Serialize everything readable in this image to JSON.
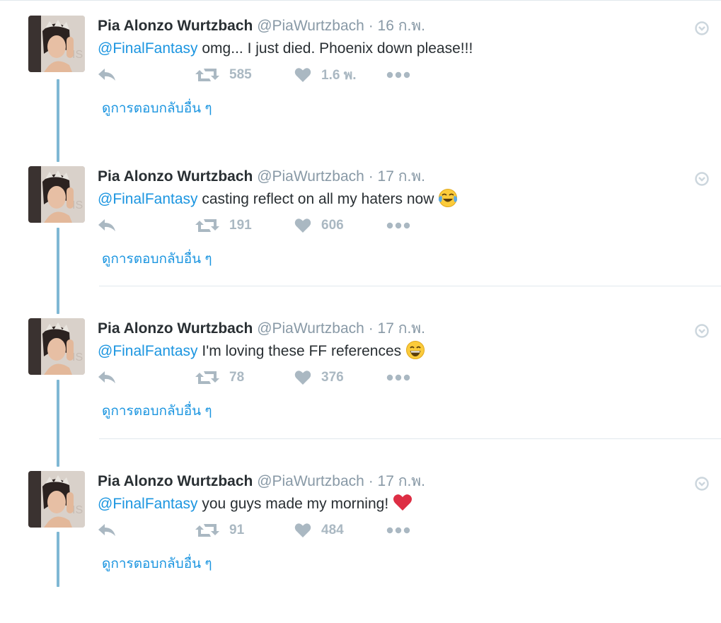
{
  "thread": {
    "more_replies_label": "ดูการตอบกลับอื่น ๆ",
    "mention_color": "#1b95e0",
    "thread_line_color": "#7fb8d4",
    "action_icon_color": "#aab8c2"
  },
  "tweets": [
    {
      "name": "Pia Alonzo Wurtzbach",
      "handle": "@PiaWurtzbach",
      "separator": "·",
      "time": "16 ก.พ.",
      "mention": "@FinalFantasy",
      "text": " omg... I just died. Phoenix down please!!!",
      "emoji": "",
      "retweets": "585",
      "likes": "1.6 พ."
    },
    {
      "name": "Pia Alonzo Wurtzbach",
      "handle": "@PiaWurtzbach",
      "separator": "·",
      "time": "17 ก.พ.",
      "mention": "@FinalFantasy",
      "text": " casting reflect on all my haters now",
      "emoji": "face-with-tears-of-joy",
      "retweets": "191",
      "likes": "606"
    },
    {
      "name": "Pia Alonzo Wurtzbach",
      "handle": "@PiaWurtzbach",
      "separator": "·",
      "time": "17 ก.พ.",
      "mention": "@FinalFantasy",
      "text": " I'm loving these FF references",
      "emoji": "grinning-face",
      "retweets": "78",
      "likes": "376"
    },
    {
      "name": "Pia Alonzo Wurtzbach",
      "handle": "@PiaWurtzbach",
      "separator": "·",
      "time": "17 ก.พ.",
      "mention": "@FinalFantasy",
      "text": " you guys made my morning!",
      "emoji": "red-heart",
      "retweets": "91",
      "likes": "484"
    }
  ]
}
